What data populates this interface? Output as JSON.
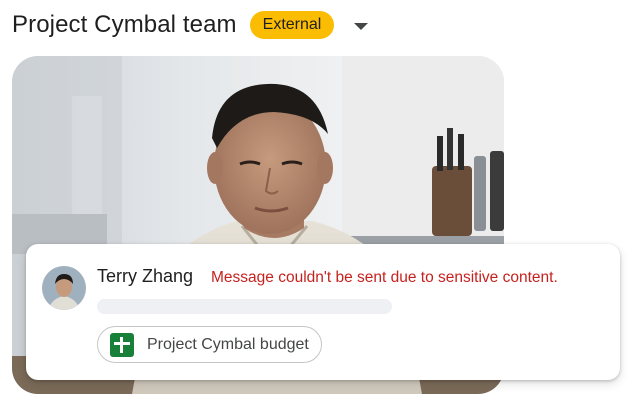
{
  "header": {
    "title": "Project Cymbal team",
    "badge": "External",
    "badge_color": "#fbbc04"
  },
  "photo": {
    "description_icon": "person-photo"
  },
  "message": {
    "sender": "Terry Zhang",
    "error": "Message couldn't be sent due to sensitive content.",
    "error_color": "#c5221f",
    "attachment": {
      "label": "Project Cymbal budget",
      "icon": "google-sheets-icon",
      "icon_color": "#188038"
    }
  }
}
